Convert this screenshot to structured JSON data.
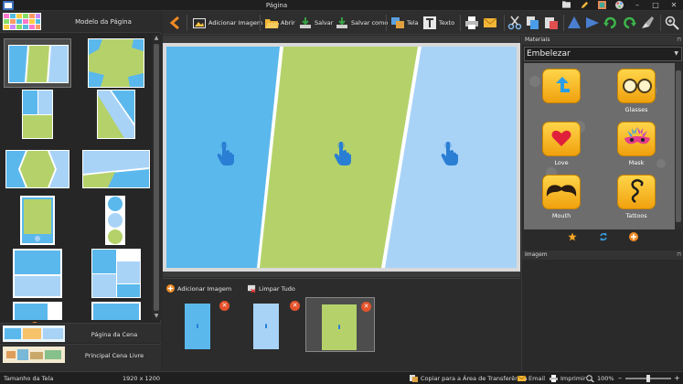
{
  "window": {
    "title": "Página",
    "controls": [
      "folder-icon",
      "pencil-icon",
      "picture-icon",
      "palette-icon",
      "minimize-icon",
      "maximize-icon",
      "close-icon"
    ]
  },
  "toolbar": {
    "add_image": "Adicionar Imagem",
    "open": "Abrir",
    "save": "Salvar",
    "save_as": "Salvar como",
    "screen": "Tela",
    "text": "Texto"
  },
  "left_panel": {
    "page_model": "Modelo da Página",
    "scene_page": "Página da Cena",
    "main_free_scene": "Principal Cena Livre",
    "selected_layout": 0
  },
  "canvas": {
    "panels": [
      {
        "color": "#5bb8ec"
      },
      {
        "color": "#b5d26a"
      },
      {
        "color": "#a8d3f7"
      }
    ]
  },
  "image_strip": {
    "add_image": "Adicionar Imagem",
    "clear_all": "Limpar Tudo",
    "images": [
      {
        "color": "#5bb8ec",
        "selected": false
      },
      {
        "color": "#a8d3f7",
        "selected": false
      },
      {
        "color": "#b5d26a",
        "selected": true
      }
    ]
  },
  "right_panel": {
    "materials_title": "Materiais",
    "category": "Embelezar",
    "items": [
      {
        "label": "",
        "icon": "arrow-icon"
      },
      {
        "label": "Glasses",
        "icon": "glasses-icon"
      },
      {
        "label": "Love",
        "icon": "heart-icon"
      },
      {
        "label": "Mask",
        "icon": "mask-icon"
      },
      {
        "label": "Mouth",
        "icon": "mustache-icon"
      },
      {
        "label": "Tattoos",
        "icon": "tattoo-icon"
      }
    ],
    "image_title": "Imagem"
  },
  "status": {
    "screen_size_label": "Tamanho da Tela",
    "screen_size_value": "1920 x 1200",
    "copy_clipboard": "Copiar para a Área de Transferência",
    "email": "Email",
    "print": "Imprimir",
    "zoom": "100%"
  }
}
